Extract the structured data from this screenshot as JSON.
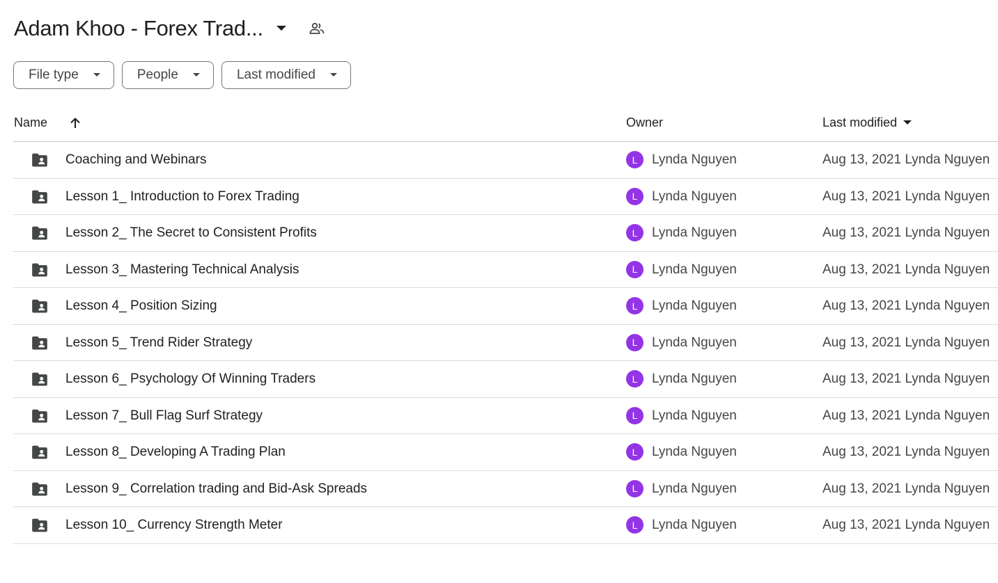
{
  "header": {
    "title": "Adam Khoo - Forex Trad...",
    "caret_icon": "caret-down-icon",
    "shared_icon": "people-icon"
  },
  "filters": [
    {
      "label": "File type"
    },
    {
      "label": "People"
    },
    {
      "label": "Last modified"
    }
  ],
  "table": {
    "columns": {
      "name": "Name",
      "owner": "Owner",
      "last_modified": "Last modified"
    },
    "sort": {
      "column": "Name",
      "direction": "ascending",
      "icon": "arrow-up-icon"
    },
    "rows": [
      {
        "name": "Coaching and Webinars",
        "owner_initial": "L",
        "owner": "Lynda Nguyen",
        "modified": "Aug 13, 2021 Lynda Nguyen"
      },
      {
        "name": "Lesson 1_ Introduction to Forex Trading",
        "owner_initial": "L",
        "owner": "Lynda Nguyen",
        "modified": "Aug 13, 2021 Lynda Nguyen"
      },
      {
        "name": "Lesson 2_ The Secret to Consistent Profits",
        "owner_initial": "L",
        "owner": "Lynda Nguyen",
        "modified": "Aug 13, 2021 Lynda Nguyen"
      },
      {
        "name": "Lesson 3_ Mastering Technical Analysis",
        "owner_initial": "L",
        "owner": "Lynda Nguyen",
        "modified": "Aug 13, 2021 Lynda Nguyen"
      },
      {
        "name": "Lesson 4_ Position Sizing",
        "owner_initial": "L",
        "owner": "Lynda Nguyen",
        "modified": "Aug 13, 2021 Lynda Nguyen"
      },
      {
        "name": "Lesson 5_ Trend Rider Strategy",
        "owner_initial": "L",
        "owner": "Lynda Nguyen",
        "modified": "Aug 13, 2021 Lynda Nguyen"
      },
      {
        "name": "Lesson 6_ Psychology Of Winning Traders",
        "owner_initial": "L",
        "owner": "Lynda Nguyen",
        "modified": "Aug 13, 2021 Lynda Nguyen"
      },
      {
        "name": "Lesson 7_ Bull Flag Surf Strategy",
        "owner_initial": "L",
        "owner": "Lynda Nguyen",
        "modified": "Aug 13, 2021 Lynda Nguyen"
      },
      {
        "name": "Lesson 8_ Developing A Trading Plan",
        "owner_initial": "L",
        "owner": "Lynda Nguyen",
        "modified": "Aug 13, 2021 Lynda Nguyen"
      },
      {
        "name": "Lesson 9_ Correlation trading and Bid-Ask Spreads",
        "owner_initial": "L",
        "owner": "Lynda Nguyen",
        "modified": "Aug 13, 2021 Lynda Nguyen"
      },
      {
        "name": "Lesson 10_ Currency Strength Meter",
        "owner_initial": "L",
        "owner": "Lynda Nguyen",
        "modified": "Aug 13, 2021 Lynda Nguyen"
      }
    ]
  },
  "colors": {
    "avatar": "#9334e6",
    "folder_icon": "#444746",
    "border": "#747775",
    "divider": "#dadce0"
  }
}
